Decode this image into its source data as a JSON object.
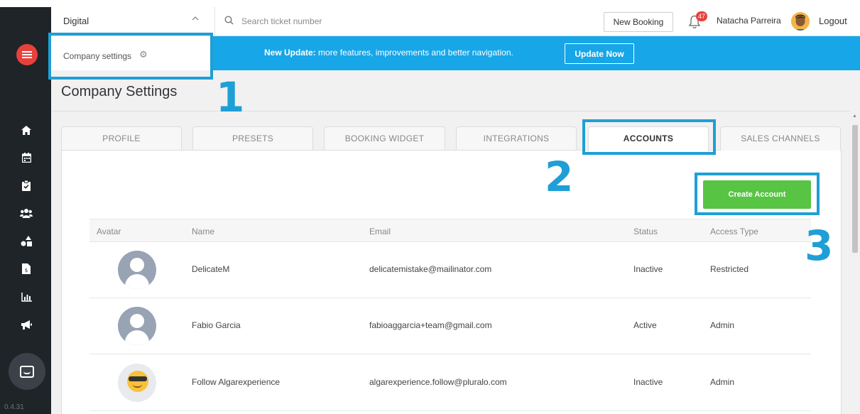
{
  "app": {
    "version": "0.4.31"
  },
  "sidebar": {
    "logo_icon": "menu-logo-icon",
    "items": [
      {
        "icon": "home-icon",
        "glyph": "⌂"
      },
      {
        "icon": "calendar-icon",
        "glyph": "▦"
      },
      {
        "icon": "clipboard-check-icon",
        "glyph": "✔"
      },
      {
        "icon": "users-icon",
        "glyph": "●"
      },
      {
        "icon": "shapes-icon",
        "glyph": "▲"
      },
      {
        "icon": "invoice-icon",
        "glyph": "$"
      },
      {
        "icon": "bar-chart-icon",
        "glyph": "▮"
      },
      {
        "icon": "megaphone-icon",
        "glyph": "◀"
      }
    ],
    "chat_icon": "chat-icon"
  },
  "topbar": {
    "workspace": "Digital",
    "search_placeholder": "Search ticket number",
    "new_booking_label": "New Booking",
    "notification_count": "47",
    "user_name": "Natacha Parreira",
    "logout_label": "Logout"
  },
  "banner": {
    "crumb": "Company settings",
    "headline": "New Update:",
    "message": " more features, improvements and better navigation.",
    "update_label": "Update Now"
  },
  "page": {
    "title": "Company Settings"
  },
  "tabs": [
    {
      "label": "PROFILE",
      "active": false
    },
    {
      "label": "PRESETS",
      "active": false
    },
    {
      "label": "BOOKING WIDGET",
      "active": false
    },
    {
      "label": "INTEGRATIONS",
      "active": false
    },
    {
      "label": "ACCOUNTS",
      "active": true
    },
    {
      "label": "SALES CHANNELS",
      "active": false
    }
  ],
  "accounts": {
    "create_label": "Create Account",
    "columns": [
      "Avatar",
      "Name",
      "Email",
      "Status",
      "Access Type"
    ],
    "rows": [
      {
        "name": "DelicateM",
        "email": "delicatemistake@mailinator.com",
        "status": "Inactive",
        "access": "Restricted",
        "avatar": "default-avatar-icon"
      },
      {
        "name": "Fabio Garcia",
        "email": "fabioaggarcia+team@gmail.com",
        "status": "Active",
        "access": "Admin",
        "avatar": "default-avatar-icon"
      },
      {
        "name": "Follow Algarexperience",
        "email": "algarexperience.follow@pluralo.com",
        "status": "Inactive",
        "access": "Admin",
        "avatar": "sunglasses-emoji-avatar"
      }
    ]
  },
  "annotations": {
    "step1": "1",
    "step2": "2",
    "step3": "3",
    "color": "#1f9fd6"
  },
  "colors": {
    "sidebar": "#1f2429",
    "brand_red": "#e8413c",
    "banner_blue": "#17a6e8",
    "create_green": "#58c443"
  }
}
